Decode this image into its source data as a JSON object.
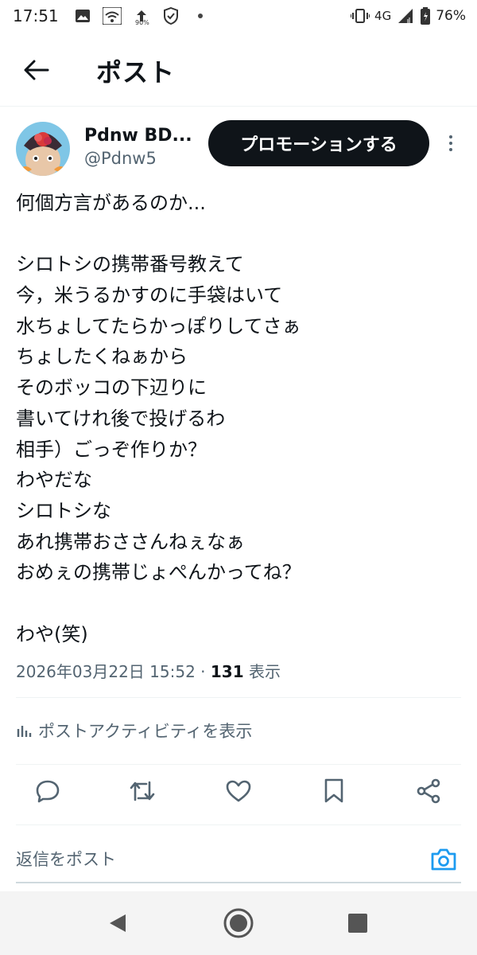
{
  "status_bar": {
    "time": "17:51",
    "data_speed": "90%",
    "network": "4G",
    "battery": "76%"
  },
  "header": {
    "back_icon": "arrow-left-icon",
    "title": "ポスト"
  },
  "author": {
    "display_name": "Pdnw BD...",
    "handle": "@Pdnw5",
    "promote_label": "プロモーションする"
  },
  "post": {
    "lines": [
      "何個方言があるのか...",
      "",
      "シロトシの携帯番号教えて",
      "今，米うるかすのに手袋はいて",
      "水ちょしてたらかっぽりしてさぁ",
      "ちょしたくねぁから",
      "そのボッコの下辺りに",
      "書いてけれ後で投げるわ",
      "相手）ごっぞ作りか？",
      "わやだな",
      "シロトシな",
      "あれ携帯おささんねぇなぁ",
      "おめぇの携帯じょぺんかってね？",
      "",
      "わや(笑)"
    ],
    "timestamp": "2026年03月22日 15:52",
    "separator": " · ",
    "views_count": "131",
    "views_label": " 表示"
  },
  "activity": {
    "label": "ポストアクティビティを表示"
  },
  "actions": [
    "reply-icon",
    "repost-icon",
    "like-icon",
    "bookmark-icon",
    "share-icon"
  ],
  "reply": {
    "placeholder": "返信をポスト"
  },
  "colors": {
    "text": "#0f1419",
    "secondary": "#536471",
    "accent": "#1d9bf0",
    "button_dark": "#0f1419"
  }
}
